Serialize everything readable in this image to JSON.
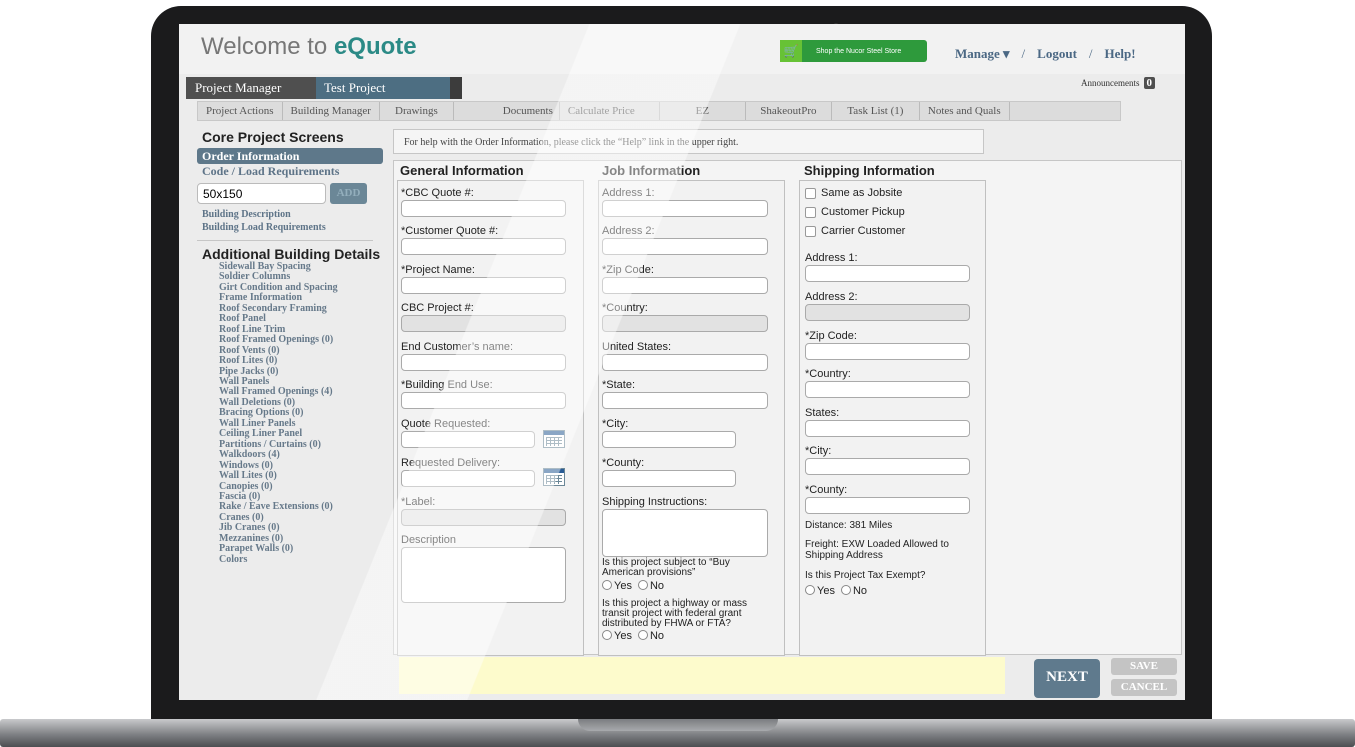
{
  "header": {
    "title_prefix": "Welcome to ",
    "title_brand": "eQuote",
    "store_label": "Shop the Nucor Steel Store",
    "manage_label": "Manage ▾",
    "logout_label": "Logout",
    "help_label": "Help!",
    "separator": "/",
    "announcements_label": "Announcements",
    "announcements_count": "0"
  },
  "tabs": {
    "project_manager": "Project Manager",
    "test_project": "Test Project"
  },
  "subtabs": [
    "Project Actions",
    "Building Manager",
    "Drawings",
    "Documents",
    "Calculate Price",
    "EZ",
    "ShakeoutPro",
    "Task List (1)",
    "Notes and Quals",
    ""
  ],
  "sidebar": {
    "core_title": "Core Project Screens",
    "order_information": "Order Information",
    "code_load": "Code / Load Requirements",
    "building_size": "50x150",
    "add_label": "ADD",
    "building_description": "Building Description",
    "building_load": "Building Load Requirements",
    "additional_title": "Additional Building Details",
    "details": [
      "Sidewall Bay Spacing",
      "Soldier Columns",
      "Girt Condition and Spacing",
      "Frame Information",
      "Roof Secondary Framing",
      "Roof Panel",
      "Roof Line Trim",
      "Roof Framed Openings (0)",
      "Roof Vents (0)",
      "Roof Lites (0)",
      "Pipe Jacks (0)",
      "Wall Panels",
      "Wall Framed Openings (4)",
      "Wall Deletions (0)",
      "Bracing Options (0)",
      "Wall Liner Panels",
      "Ceiling Liner Panel",
      "Partitions / Curtains (0)",
      "Walkdoors (4)",
      "Windows (0)",
      "Wall Lites (0)",
      "Canopies (0)",
      "Fascia (0)",
      "Rake / Eave Extensions (0)",
      "Cranes (0)",
      "Jib Cranes (0)",
      "Mezzanines (0)",
      "Parapet Walls (0)",
      "Colors"
    ]
  },
  "help_text": "For help with the Order Information, please click the “Help” link in the upper right.",
  "general": {
    "title": "General Information",
    "cbc_quote": "*CBC Quote #:",
    "customer_quote": "*Customer Quote #:",
    "project_name": "*Project Name:",
    "cbc_project": "CBC Project #:",
    "end_customer": "End Customer’s name:",
    "building_end_use": "*Building End Use:",
    "quote_requested": "Quote Requested:",
    "requested_delivery": "Requested Delivery:",
    "label": "*Label:",
    "description": "Description"
  },
  "job": {
    "title": "Job Information",
    "address1": "Address 1:",
    "address2": "Address 2:",
    "zip": "*Zip Code:",
    "country": "*Country:",
    "united_states": "United States:",
    "state": "*State:",
    "city": "*City:",
    "county": "*County:",
    "shipping_instructions": "Shipping Instructions:",
    "buy_american_q": "Is this project subject to “Buy American provisions”",
    "highway_q": "Is this project a highway or mass transit project with federal grant distributed by FHWA or FTA?",
    "yes": "Yes",
    "no": "No"
  },
  "shipping": {
    "title": "Shipping Information",
    "same_as_jobsite": "Same as Jobsite",
    "customer_pickup": "Customer Pickup",
    "carrier_customer": "Carrier Customer",
    "address1": "Address 1:",
    "address2": "Address 2:",
    "zip": "*Zip Code:",
    "country": "*Country:",
    "states": "States:",
    "city": "*City:",
    "county": "*County:",
    "distance": "Distance: 381 Miles",
    "freight": "Freight: EXW Loaded Allowed to Shipping Address",
    "tax_exempt_q": "Is this Project Tax Exempt?",
    "yes": "Yes",
    "no": "No"
  },
  "footer": {
    "next": "NEXT",
    "save": "SAVE",
    "cancel": "CANCEL"
  },
  "colors": {
    "brand": "#2b8a86",
    "nav_blue": "#4d6e82",
    "link": "#5e7488",
    "store_green": "#2e9a3c",
    "message_yellow": "#fdfbcc"
  }
}
